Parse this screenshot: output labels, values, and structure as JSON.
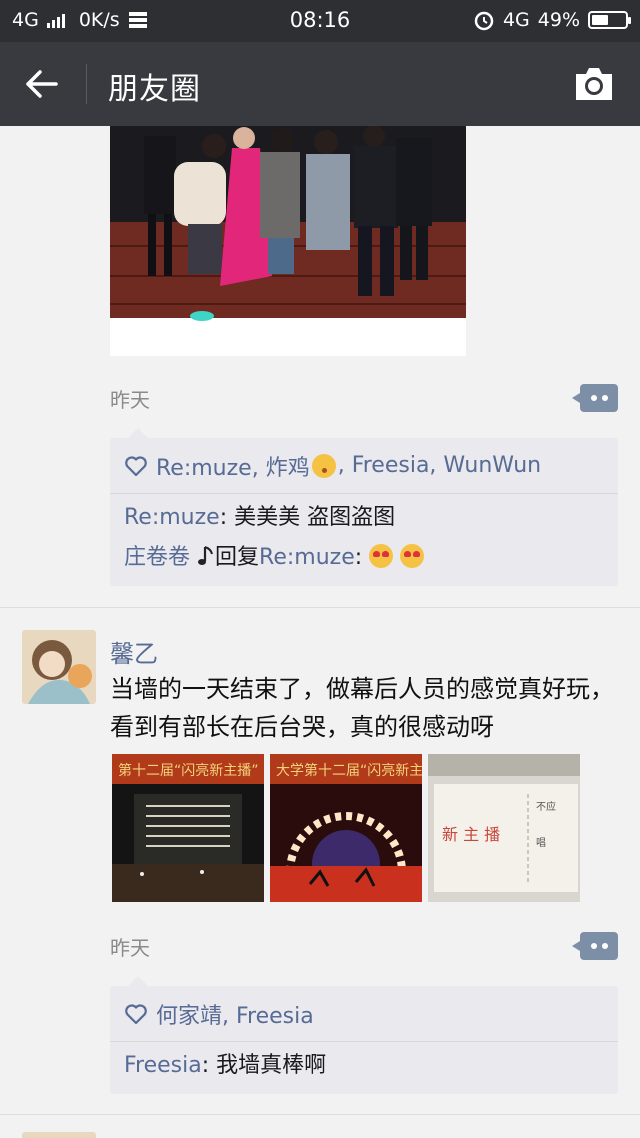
{
  "statusbar": {
    "network": "4G",
    "speed": "0K/s",
    "time": "08:16",
    "net_right": "4G",
    "battery_percent": "49%",
    "battery_level": 0.49
  },
  "navbar": {
    "title": "朋友圈",
    "back_icon": "back-arrow-icon",
    "camera_icon": "camera-icon"
  },
  "posts": [
    {
      "timestamp": "昨天",
      "likes": {
        "names_a": "Re:muze, 炸鸡",
        "names_b": ", Freesia, WunWun"
      },
      "comments": [
        {
          "author": "Re:muze",
          "sep": ": ",
          "text": "美美美 盗图盗图"
        },
        {
          "author": "庄卷卷",
          "reply_word": "回复",
          "target": "Re:muze",
          "sep": ": "
        }
      ]
    },
    {
      "username": "馨乙",
      "text": "当墙的一天结束了，做幕后人员的感觉真好玩，看到有部长在后台哭，真的很感动呀",
      "timestamp": "昨天",
      "likes": {
        "names": "何家靖, Freesia"
      },
      "comments": [
        {
          "author": "Freesia",
          "sep": ": ",
          "text": "我墙真棒啊"
        }
      ]
    }
  ],
  "colors": {
    "nav_bg": "#393a3f",
    "status_bg": "#2e2f33",
    "link_blue": "#576b95",
    "feed_bg": "#f2f2f2"
  }
}
